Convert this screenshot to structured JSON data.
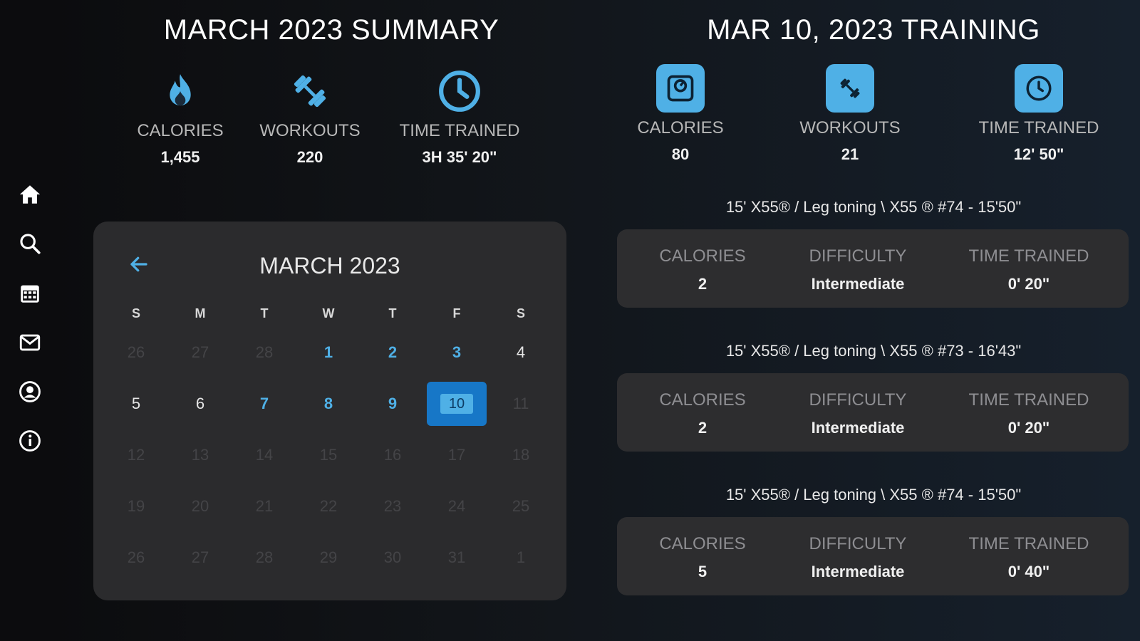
{
  "nav": {
    "items": [
      {
        "name": "home-icon"
      },
      {
        "name": "search-icon"
      },
      {
        "name": "calendar-icon"
      },
      {
        "name": "mail-icon"
      },
      {
        "name": "profile-icon"
      },
      {
        "name": "info-icon"
      }
    ]
  },
  "summary": {
    "title": "MARCH 2023 SUMMARY",
    "stats": [
      {
        "icon": "flame-icon",
        "label": "CALORIES",
        "value": "1,455"
      },
      {
        "icon": "dumbbell-icon",
        "label": "WORKOUTS",
        "value": "220"
      },
      {
        "icon": "clock-icon",
        "label": "TIME TRAINED",
        "value": "3H 35' 20\""
      }
    ]
  },
  "training": {
    "title": "MAR 10, 2023 TRAINING",
    "stats": [
      {
        "icon": "scale-icon",
        "label": "CALORIES",
        "value": "80"
      },
      {
        "icon": "dumbbell-icon",
        "label": "WORKOUTS",
        "value": "21"
      },
      {
        "icon": "clock-icon",
        "label": "TIME TRAINED",
        "value": "12' 50\""
      }
    ],
    "sessions": [
      {
        "title": "15' X55® / Leg toning \\ X55 ® #74 - 15'50\"",
        "calories_label": "CALORIES",
        "calories": "2",
        "difficulty_label": "DIFFICULTY",
        "difficulty": "Intermediate",
        "time_label": "TIME TRAINED",
        "time": "0' 20\""
      },
      {
        "title": "15' X55® / Leg toning \\ X55 ® #73 - 16'43\"",
        "calories_label": "CALORIES",
        "calories": "2",
        "difficulty_label": "DIFFICULTY",
        "difficulty": "Intermediate",
        "time_label": "TIME TRAINED",
        "time": "0' 20\""
      },
      {
        "title": "15' X55® / Leg toning \\ X55 ® #74 - 15'50\"",
        "calories_label": "CALORIES",
        "calories": "5",
        "difficulty_label": "DIFFICULTY",
        "difficulty": "Intermediate",
        "time_label": "TIME TRAINED",
        "time": "0' 40\""
      }
    ]
  },
  "calendar": {
    "title": "MARCH 2023",
    "weekdays": [
      "S",
      "M",
      "T",
      "W",
      "T",
      "F",
      "S"
    ],
    "days": [
      {
        "d": "26",
        "state": "muted"
      },
      {
        "d": "27",
        "state": "muted"
      },
      {
        "d": "28",
        "state": "muted"
      },
      {
        "d": "1",
        "state": "active"
      },
      {
        "d": "2",
        "state": "active"
      },
      {
        "d": "3",
        "state": "active"
      },
      {
        "d": "4",
        "state": "normal"
      },
      {
        "d": "5",
        "state": "normal"
      },
      {
        "d": "6",
        "state": "normal"
      },
      {
        "d": "7",
        "state": "active"
      },
      {
        "d": "8",
        "state": "active"
      },
      {
        "d": "9",
        "state": "active"
      },
      {
        "d": "10",
        "state": "selected"
      },
      {
        "d": "11",
        "state": "muted"
      },
      {
        "d": "12",
        "state": "muted"
      },
      {
        "d": "13",
        "state": "muted"
      },
      {
        "d": "14",
        "state": "muted"
      },
      {
        "d": "15",
        "state": "muted"
      },
      {
        "d": "16",
        "state": "muted"
      },
      {
        "d": "17",
        "state": "muted"
      },
      {
        "d": "18",
        "state": "muted"
      },
      {
        "d": "19",
        "state": "muted"
      },
      {
        "d": "20",
        "state": "muted"
      },
      {
        "d": "21",
        "state": "muted"
      },
      {
        "d": "22",
        "state": "muted"
      },
      {
        "d": "23",
        "state": "muted"
      },
      {
        "d": "24",
        "state": "muted"
      },
      {
        "d": "25",
        "state": "muted"
      },
      {
        "d": "26",
        "state": "muted"
      },
      {
        "d": "27",
        "state": "muted"
      },
      {
        "d": "28",
        "state": "muted"
      },
      {
        "d": "29",
        "state": "muted"
      },
      {
        "d": "30",
        "state": "muted"
      },
      {
        "d": "31",
        "state": "muted"
      },
      {
        "d": "1",
        "state": "muted"
      }
    ]
  },
  "colors": {
    "accent": "#4fb0e6",
    "selected_bg": "#1777c7",
    "card_bg": "#2d2d2f"
  }
}
